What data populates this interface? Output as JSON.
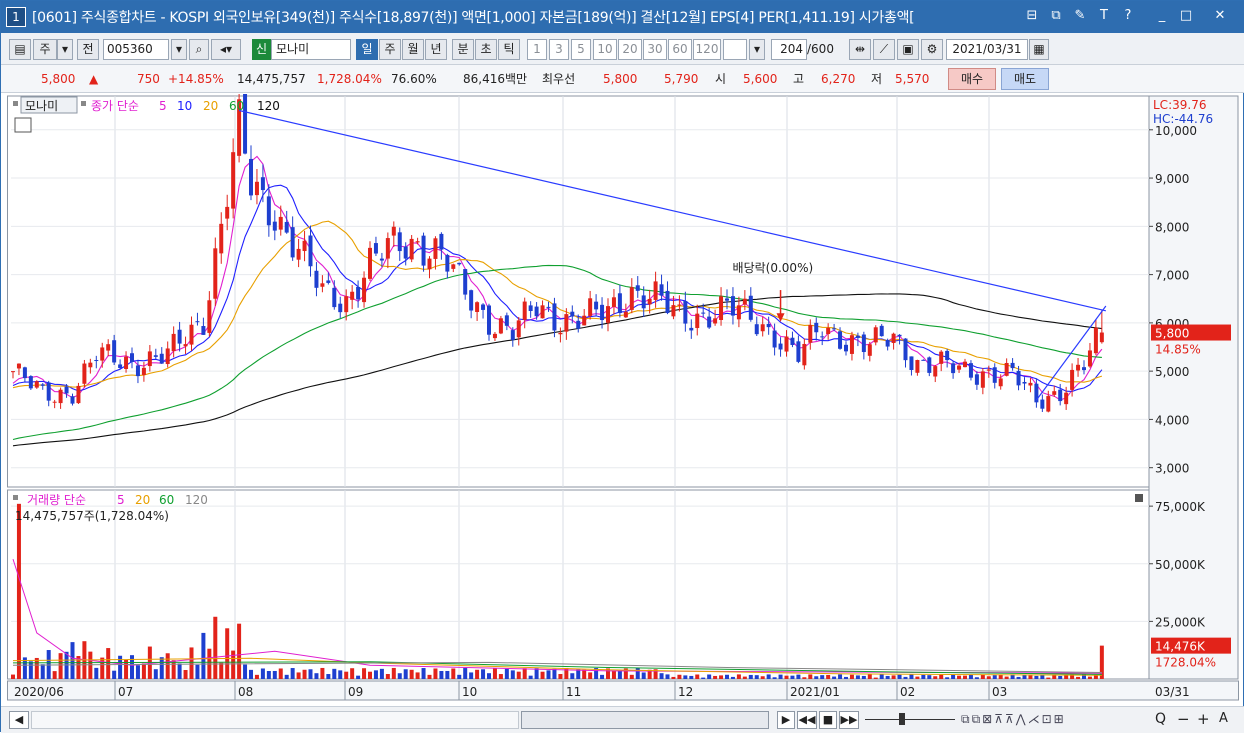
{
  "window": {
    "number": "1",
    "title": "[0601] 주식종합차트 - KOSPI 외국인보유[349(천)] 주식수[18,897(천)] 액면[1,000] 자본금[189(억)] 결산[12월] EPS[4] PER[1,411.19] 시가총액[",
    "buttons": [
      "⊟",
      "⧉",
      "✎",
      "T",
      "?",
      "_",
      "□",
      "✕"
    ]
  },
  "toolbar": {
    "period_label": "주",
    "prev_label": "전",
    "code": "005360",
    "mode_badge": "신",
    "stock_name": "모나미",
    "period_buttons": [
      "일",
      "주",
      "월",
      "년",
      "분",
      "초",
      "틱"
    ],
    "active_period": "일",
    "interval_buttons": [
      "1",
      "3",
      "5",
      "10",
      "20",
      "30",
      "60",
      "120"
    ],
    "count": "204",
    "count_total": "/600",
    "date": "2021/03/31"
  },
  "quote": {
    "price": "5,800",
    "arrow": "▲",
    "change": "750",
    "change_pct": "+14.85%",
    "volume": "14,475,757",
    "volume_pct": "1,728.04%",
    "ratio": "76.60%",
    "amount": "86,416백만",
    "best_label": "최우선",
    "best_ask": "5,800",
    "best_bid": "5,790",
    "open_label": "시",
    "open": "5,600",
    "high_label": "고",
    "high": "6,270",
    "low_label": "저",
    "low": "5,570",
    "buy_label": "매수",
    "sell_label": "매도"
  },
  "price_legend": {
    "name": "모나미",
    "ma_label": "종가 단순",
    "periods": [
      "5",
      "10",
      "20",
      "60",
      "120"
    ]
  },
  "volume_legend": {
    "label": "거래량 단순",
    "periods": [
      "5",
      "20",
      "60",
      "120"
    ],
    "info": "14,475,757주(1,728.04%)"
  },
  "annotations": {
    "dividend": "배당락(0.00%)",
    "lc": "LC:39.76",
    "hc": "HC:-44.76",
    "price_tag": "5,800",
    "pct_tag": "14.85%",
    "vol_tag": "14,476K",
    "vol_pct_tag": "1728.04%"
  },
  "colors": {
    "up": "#e2231a",
    "down": "#1e3fcf",
    "ma5": "#e020d0",
    "ma10": "#2020ff",
    "ma20": "#e8a000",
    "ma60": "#10a030",
    "ma120": "#111111",
    "trendline": "#2a3cff"
  },
  "chart_data": {
    "type": "candlestick",
    "period": "daily",
    "price_axis": {
      "ticks": [
        "10,000",
        "9,000",
        "8,000",
        "7,000",
        "6,000",
        "5,000",
        "4,000",
        "3,000"
      ],
      "tick_values": [
        10000,
        9000,
        8000,
        7000,
        6000,
        5000,
        4000,
        3000
      ],
      "range": [
        2600,
        10700
      ]
    },
    "volume_axis": {
      "ticks": [
        "75,000K",
        "50,000K",
        "25,000K"
      ],
      "tick_values": [
        75000,
        50000,
        25000
      ],
      "range": [
        0,
        82000
      ],
      "unit": "K"
    },
    "x_axis": {
      "labels": [
        "2020/06",
        "07",
        "08",
        "09",
        "10",
        "11",
        "12",
        "2021/01",
        "02",
        "03",
        "03/31"
      ]
    },
    "close_path": [
      [
        0,
        5000
      ],
      [
        5,
        4500
      ],
      [
        10,
        4600
      ],
      [
        14,
        5300
      ],
      [
        20,
        5200
      ],
      [
        26,
        5300
      ],
      [
        32,
        6100
      ],
      [
        36,
        8700
      ],
      [
        38,
        10000
      ],
      [
        40,
        8800
      ],
      [
        44,
        8300
      ],
      [
        48,
        7500
      ],
      [
        52,
        6600
      ],
      [
        56,
        6500
      ],
      [
        60,
        7200
      ],
      [
        64,
        7600
      ],
      [
        68,
        7700
      ],
      [
        72,
        7400
      ],
      [
        76,
        6600
      ],
      [
        80,
        6100
      ],
      [
        84,
        5800
      ],
      [
        88,
        6300
      ],
      [
        92,
        6100
      ],
      [
        96,
        6100
      ],
      [
        100,
        6200
      ],
      [
        104,
        6700
      ],
      [
        108,
        6500
      ],
      [
        112,
        6100
      ],
      [
        116,
        6200
      ],
      [
        120,
        6300
      ],
      [
        124,
        6100
      ],
      [
        128,
        5800
      ],
      [
        132,
        5300
      ],
      [
        136,
        5900
      ],
      [
        140,
        5700
      ],
      [
        144,
        5500
      ],
      [
        148,
        5700
      ],
      [
        152,
        5200
      ],
      [
        156,
        5100
      ],
      [
        160,
        5000
      ],
      [
        164,
        5000
      ],
      [
        168,
        4900
      ],
      [
        172,
        4400
      ],
      [
        176,
        4600
      ],
      [
        180,
        5100
      ],
      [
        183,
        5800
      ]
    ],
    "trendline": {
      "from": [
        38,
        10400
      ],
      "to": [
        183,
        6250
      ]
    },
    "dividend_marker": {
      "index": 129
    }
  },
  "bottom": {
    "scroll_left": "◀",
    "scroll_right": "▶",
    "nav": [
      "▶",
      "◀◀",
      "■",
      "▶▶"
    ],
    "tools": [
      "Q",
      "−",
      "+",
      "A"
    ]
  }
}
